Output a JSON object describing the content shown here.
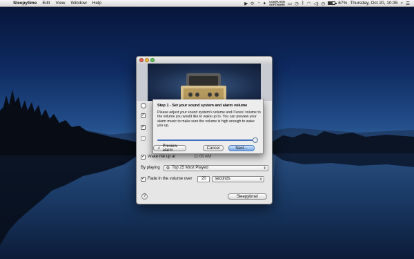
{
  "menubar": {
    "apple_icon": "apple-logo-icon",
    "app_name": "Sleepytime",
    "menus": [
      "Edit",
      "View",
      "Window",
      "Help"
    ],
    "status": {
      "cs_line1": "COMPUTER",
      "cs_line2": "SOFTWARE",
      "battery_percent": "67%",
      "battery_level": 0.67,
      "datetime": "Thursday, Oct 20, 10:35"
    }
  },
  "window": {
    "peek_row_label": "Wake me up at",
    "peek_row_value": "11:00 AM",
    "play_label": "By playing",
    "playlist_value": "Top 25 Most Played",
    "fade_label": "Fade in the volume over",
    "fade_value": "20",
    "fade_unit": "seconds",
    "help_label": "?",
    "sleepytime_button": "Sleepytime!"
  },
  "sheet": {
    "heading": "Step 1 - Set your sound system and alarm volume",
    "body": "Please adjust your sound system's volume and iTunes' volume to the volume you would like to wake up to. You can preview your alarm music to make sure the volume is high enough to wake you up.",
    "volume_level": 0.98,
    "preview_label": "Preview alarm",
    "cancel_label": "Cancel",
    "next_label": "Next..."
  },
  "colors": {
    "accent": "#3e6fb8",
    "close": "#ec5f55",
    "minimize": "#f5bd41",
    "zoom": "#5ec55a"
  }
}
